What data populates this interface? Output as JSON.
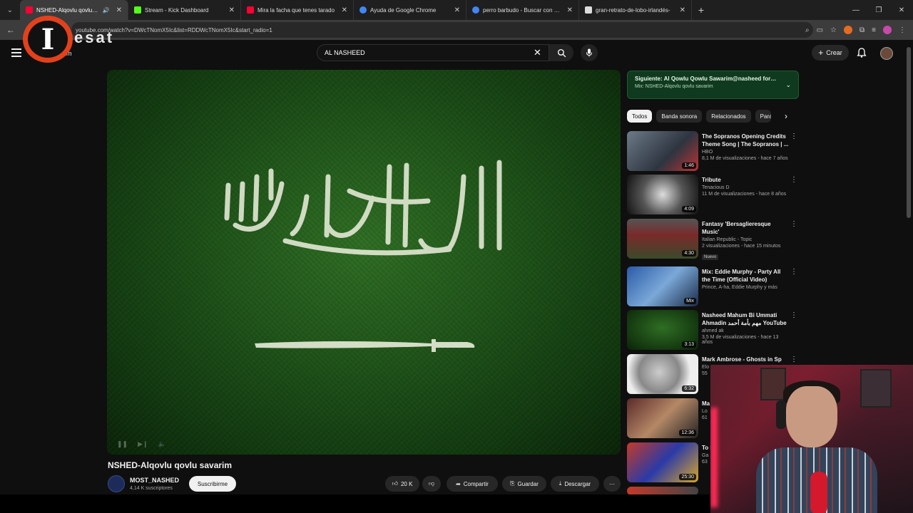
{
  "browser": {
    "tabs": [
      {
        "title": "NSHED-Alqovlu qovlu sava",
        "favicon_color": "#ff0033",
        "active": true
      },
      {
        "title": "Stream - Kick Dashboard",
        "favicon_color": "#53fc18",
        "active": false
      },
      {
        "title": "Mira la facha que tenes tarado",
        "favicon_color": "#ff0033",
        "active": false
      },
      {
        "title": "Ayuda de Google Chrome",
        "favicon_color": "#4285f4",
        "active": false
      },
      {
        "title": "perro barbudo - Buscar con Go",
        "favicon_color": "#4285f4",
        "active": false
      },
      {
        "title": "gran-retrato-de-lobo-irlandés-",
        "favicon_color": "#dddddd",
        "active": false
      }
    ],
    "new_tab": "+",
    "url": "youtube.com/watch?v=DWcTNomX5Ic&list=RDDWcTNomX5Ic&start_radio=1"
  },
  "overlay_logo": {
    "letter": "I",
    "text": "esat"
  },
  "header": {
    "brand_fragment": "um",
    "search_value": "AL NASHEED",
    "create_label": "Crear"
  },
  "video": {
    "title": "NSHED-Alqovlu qovlu savarim",
    "channel": "MOST_NASHED",
    "subscribers": "4,14 K suscriptores",
    "subscribe_label": "Suscribirme",
    "likes": "20 K",
    "share_label": "Compartir",
    "save_label": "Guardar",
    "download_label": "Descargar"
  },
  "next_up": {
    "title": "Siguiente: Al Qowlu Qowlu Sawarim@nasheed for m...",
    "subtitle": "Mix: NSHED-Alqovlu qovlu savarim"
  },
  "chips": [
    "Todos",
    "Banda sonora",
    "Relacionados",
    "Para"
  ],
  "recommendations": [
    {
      "title": "The Sopranos Opening Credits Theme Song | The Sopranos | ...",
      "channel": "HBO",
      "meta": "8,1 M de visualizaciones - hace 7 años",
      "duration": "1:46"
    },
    {
      "title": "Tribute",
      "channel": "Tenacious D",
      "meta": "11 M de visualizaciones - hace 8 años",
      "duration": "4:09"
    },
    {
      "title": "Fantasy 'Bersaglieresque Music'",
      "channel": "Italian Republic - Topic",
      "meta": "2 visualizaciones - hace 15 minutos",
      "duration": "4:30",
      "badge": "Nuevo"
    },
    {
      "title": "Mix: Eddie Murphy - Party All the Time (Official Video)",
      "channel": "Prince, A-ha, Eddie Murphy y más",
      "meta": "",
      "duration": "Mix"
    },
    {
      "title": "Nasheed  Mahum Bi Ummati Ahmadin مهم بأمة أحمد  YouTube",
      "channel": "ahmed ak",
      "meta": "3,5 M de visualizaciones - hace 13 años",
      "duration": "3:13"
    },
    {
      "title": "Mark Ambrose - Ghosts in Sp",
      "channel": "Elo",
      "meta": "55",
      "duration": "6:32"
    },
    {
      "title": "Ma or",
      "channel": "Lo",
      "meta": "61",
      "duration": "12:36"
    },
    {
      "title": "To Be",
      "channel": "Ga",
      "meta": "63",
      "duration": "25:30"
    }
  ],
  "colors": {
    "accent": "#ff0033",
    "next_card": "#0f3a1f",
    "logo_ring": "#e3411c"
  }
}
